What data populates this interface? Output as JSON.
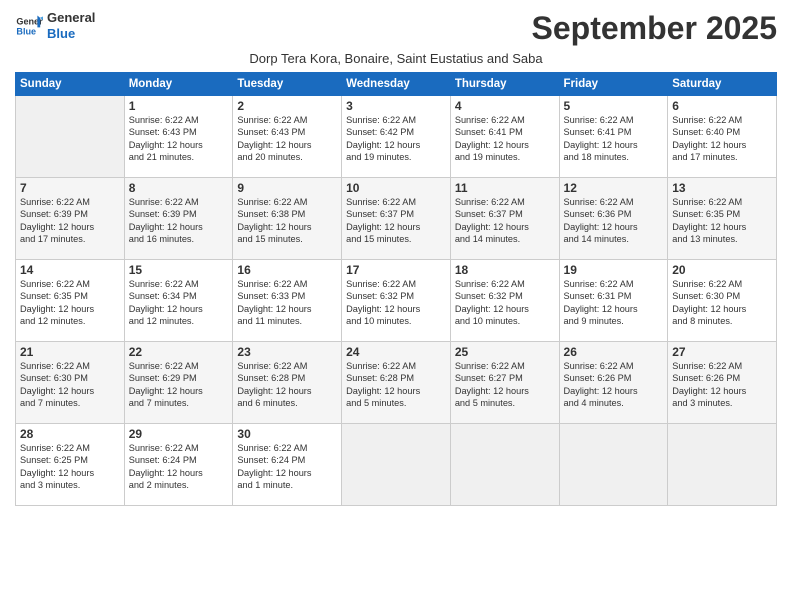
{
  "logo": {
    "line1": "General",
    "line2": "Blue"
  },
  "title": "September 2025",
  "subtitle": "Dorp Tera Kora, Bonaire, Saint Eustatius and Saba",
  "days_of_week": [
    "Sunday",
    "Monday",
    "Tuesday",
    "Wednesday",
    "Thursday",
    "Friday",
    "Saturday"
  ],
  "weeks": [
    [
      {
        "day": "",
        "info": ""
      },
      {
        "day": "1",
        "info": "Sunrise: 6:22 AM\nSunset: 6:43 PM\nDaylight: 12 hours\nand 21 minutes."
      },
      {
        "day": "2",
        "info": "Sunrise: 6:22 AM\nSunset: 6:43 PM\nDaylight: 12 hours\nand 20 minutes."
      },
      {
        "day": "3",
        "info": "Sunrise: 6:22 AM\nSunset: 6:42 PM\nDaylight: 12 hours\nand 19 minutes."
      },
      {
        "day": "4",
        "info": "Sunrise: 6:22 AM\nSunset: 6:41 PM\nDaylight: 12 hours\nand 19 minutes."
      },
      {
        "day": "5",
        "info": "Sunrise: 6:22 AM\nSunset: 6:41 PM\nDaylight: 12 hours\nand 18 minutes."
      },
      {
        "day": "6",
        "info": "Sunrise: 6:22 AM\nSunset: 6:40 PM\nDaylight: 12 hours\nand 17 minutes."
      }
    ],
    [
      {
        "day": "7",
        "info": "Sunrise: 6:22 AM\nSunset: 6:39 PM\nDaylight: 12 hours\nand 17 minutes."
      },
      {
        "day": "8",
        "info": "Sunrise: 6:22 AM\nSunset: 6:39 PM\nDaylight: 12 hours\nand 16 minutes."
      },
      {
        "day": "9",
        "info": "Sunrise: 6:22 AM\nSunset: 6:38 PM\nDaylight: 12 hours\nand 15 minutes."
      },
      {
        "day": "10",
        "info": "Sunrise: 6:22 AM\nSunset: 6:37 PM\nDaylight: 12 hours\nand 15 minutes."
      },
      {
        "day": "11",
        "info": "Sunrise: 6:22 AM\nSunset: 6:37 PM\nDaylight: 12 hours\nand 14 minutes."
      },
      {
        "day": "12",
        "info": "Sunrise: 6:22 AM\nSunset: 6:36 PM\nDaylight: 12 hours\nand 14 minutes."
      },
      {
        "day": "13",
        "info": "Sunrise: 6:22 AM\nSunset: 6:35 PM\nDaylight: 12 hours\nand 13 minutes."
      }
    ],
    [
      {
        "day": "14",
        "info": "Sunrise: 6:22 AM\nSunset: 6:35 PM\nDaylight: 12 hours\nand 12 minutes."
      },
      {
        "day": "15",
        "info": "Sunrise: 6:22 AM\nSunset: 6:34 PM\nDaylight: 12 hours\nand 12 minutes."
      },
      {
        "day": "16",
        "info": "Sunrise: 6:22 AM\nSunset: 6:33 PM\nDaylight: 12 hours\nand 11 minutes."
      },
      {
        "day": "17",
        "info": "Sunrise: 6:22 AM\nSunset: 6:32 PM\nDaylight: 12 hours\nand 10 minutes."
      },
      {
        "day": "18",
        "info": "Sunrise: 6:22 AM\nSunset: 6:32 PM\nDaylight: 12 hours\nand 10 minutes."
      },
      {
        "day": "19",
        "info": "Sunrise: 6:22 AM\nSunset: 6:31 PM\nDaylight: 12 hours\nand 9 minutes."
      },
      {
        "day": "20",
        "info": "Sunrise: 6:22 AM\nSunset: 6:30 PM\nDaylight: 12 hours\nand 8 minutes."
      }
    ],
    [
      {
        "day": "21",
        "info": "Sunrise: 6:22 AM\nSunset: 6:30 PM\nDaylight: 12 hours\nand 7 minutes."
      },
      {
        "day": "22",
        "info": "Sunrise: 6:22 AM\nSunset: 6:29 PM\nDaylight: 12 hours\nand 7 minutes."
      },
      {
        "day": "23",
        "info": "Sunrise: 6:22 AM\nSunset: 6:28 PM\nDaylight: 12 hours\nand 6 minutes."
      },
      {
        "day": "24",
        "info": "Sunrise: 6:22 AM\nSunset: 6:28 PM\nDaylight: 12 hours\nand 5 minutes."
      },
      {
        "day": "25",
        "info": "Sunrise: 6:22 AM\nSunset: 6:27 PM\nDaylight: 12 hours\nand 5 minutes."
      },
      {
        "day": "26",
        "info": "Sunrise: 6:22 AM\nSunset: 6:26 PM\nDaylight: 12 hours\nand 4 minutes."
      },
      {
        "day": "27",
        "info": "Sunrise: 6:22 AM\nSunset: 6:26 PM\nDaylight: 12 hours\nand 3 minutes."
      }
    ],
    [
      {
        "day": "28",
        "info": "Sunrise: 6:22 AM\nSunset: 6:25 PM\nDaylight: 12 hours\nand 3 minutes."
      },
      {
        "day": "29",
        "info": "Sunrise: 6:22 AM\nSunset: 6:24 PM\nDaylight: 12 hours\nand 2 minutes."
      },
      {
        "day": "30",
        "info": "Sunrise: 6:22 AM\nSunset: 6:24 PM\nDaylight: 12 hours\nand 1 minute."
      },
      {
        "day": "",
        "info": ""
      },
      {
        "day": "",
        "info": ""
      },
      {
        "day": "",
        "info": ""
      },
      {
        "day": "",
        "info": ""
      }
    ]
  ]
}
